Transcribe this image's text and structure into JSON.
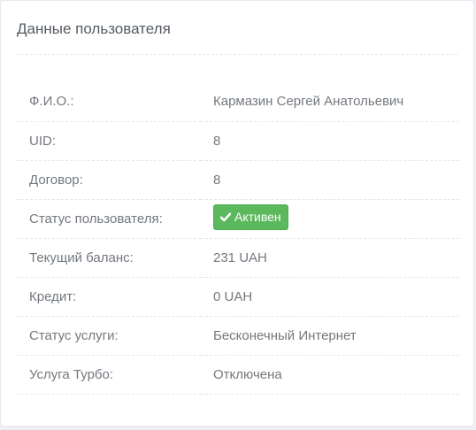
{
  "panel": {
    "title": "Данные пользователя"
  },
  "rows": [
    {
      "label": "Ф.И.О.:",
      "value": "Кармазин Сергей Анатольевич"
    },
    {
      "label": "UID:",
      "value": "8"
    },
    {
      "label": "Договор:",
      "value": "8"
    },
    {
      "label": "Статус пользователя:",
      "badge": "Активен",
      "badge_icon": "check-icon",
      "badge_color": "#5cb85c"
    },
    {
      "label": "Текущий баланс:",
      "value": "231 UAH"
    },
    {
      "label": "Кредит:",
      "value": "0 UAH"
    },
    {
      "label": "Статус услуги:",
      "value": "Бесконечный Интернет"
    },
    {
      "label": "Услуга Турбо:",
      "value": "Отключена"
    }
  ]
}
